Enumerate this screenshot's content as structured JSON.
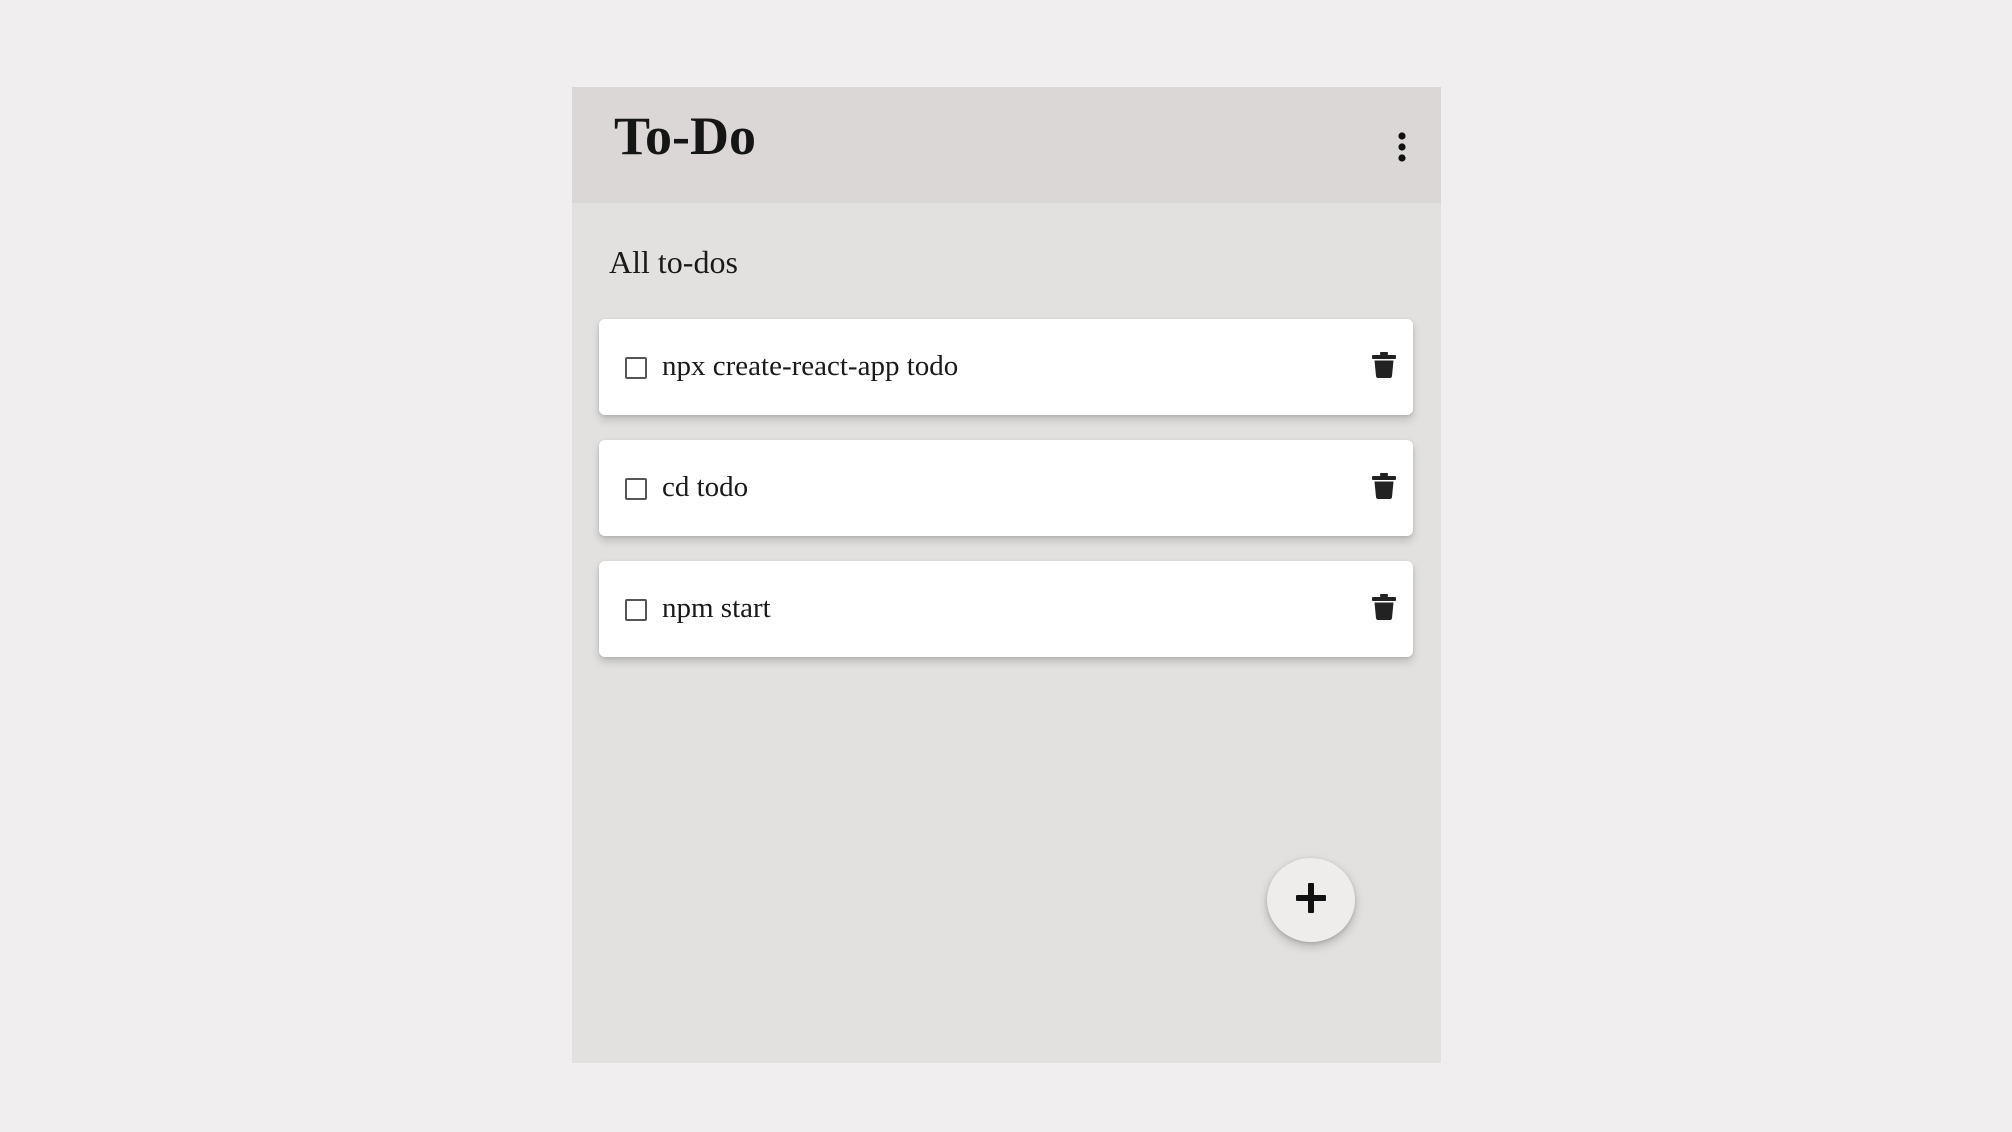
{
  "header": {
    "title": "To-Do",
    "menu_icon": "more-vertical-icon"
  },
  "main": {
    "heading": "All to-dos",
    "todos": [
      {
        "text": "npx create-react-app todo",
        "checked": false,
        "delete_icon": "trash-icon"
      },
      {
        "text": "cd todo",
        "checked": false,
        "delete_icon": "trash-icon"
      },
      {
        "text": "npm start",
        "checked": false,
        "delete_icon": "trash-icon"
      }
    ]
  },
  "fab": {
    "icon": "plus-icon"
  },
  "colors": {
    "page_background": "#f0eeee",
    "app_background": "#e2e1e0",
    "header_background": "#dbd7d6",
    "card_background": "#ffffff",
    "icon_color": "#222222"
  }
}
